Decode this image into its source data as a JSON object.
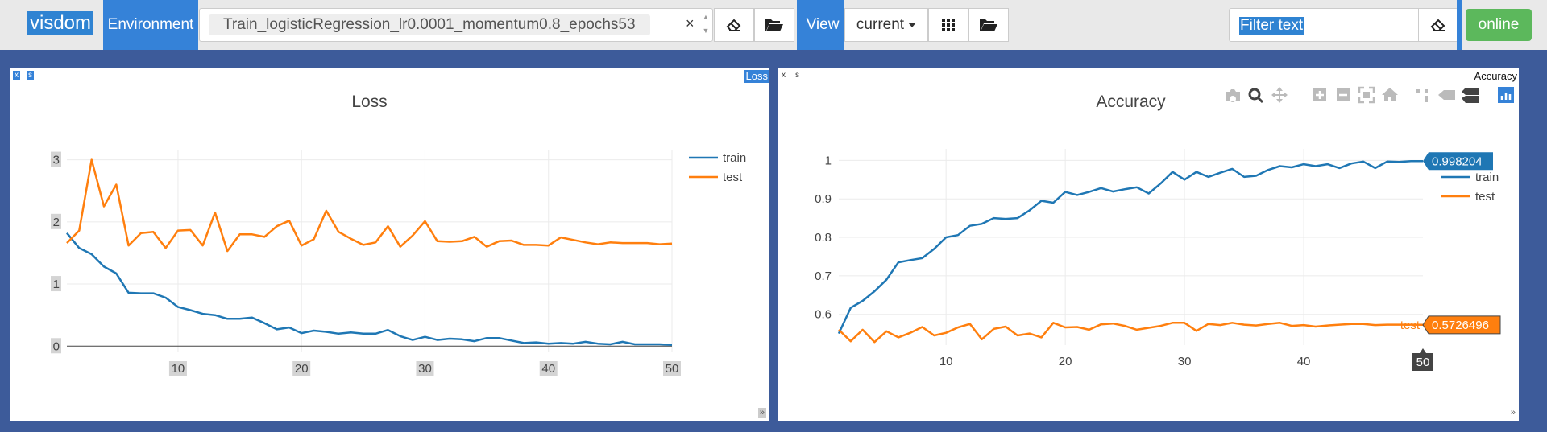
{
  "app": {
    "logo": "visdom",
    "environment_label": "Environment",
    "environment_value": "Train_logisticRegression_lr0.0001_momentum0.8_epochs53",
    "view_label": "View",
    "view_value": "current",
    "filter_text": "Filter text",
    "online_label": "online"
  },
  "panes": {
    "loss": {
      "close": "x",
      "save": "s",
      "tag": "Loss"
    },
    "accuracy": {
      "close": "x",
      "save": "s",
      "tag": "Accuracy"
    }
  },
  "colors": {
    "train": "#1f77b4",
    "test": "#ff7f0e",
    "accent": "#3582d8",
    "online": "#5cb85c"
  },
  "chart_data": [
    {
      "type": "line",
      "title": "Loss",
      "xlim": [
        1,
        50
      ],
      "ylim": [
        -0.1,
        3.15
      ],
      "xticks": [
        10,
        20,
        30,
        40,
        50
      ],
      "yticks": [
        0,
        1,
        2,
        3
      ],
      "grid": true,
      "legend": "top-right",
      "x": [
        1,
        2,
        3,
        4,
        5,
        6,
        7,
        8,
        9,
        10,
        11,
        12,
        13,
        14,
        15,
        16,
        17,
        18,
        19,
        20,
        21,
        22,
        23,
        24,
        25,
        26,
        27,
        28,
        29,
        30,
        31,
        32,
        33,
        34,
        35,
        36,
        37,
        38,
        39,
        40,
        41,
        42,
        43,
        44,
        45,
        46,
        47,
        48,
        49,
        50
      ],
      "series": [
        {
          "name": "train",
          "values": [
            1.82,
            1.58,
            1.48,
            1.28,
            1.17,
            0.86,
            0.85,
            0.85,
            0.78,
            0.63,
            0.58,
            0.52,
            0.5,
            0.44,
            0.44,
            0.46,
            0.37,
            0.27,
            0.3,
            0.21,
            0.25,
            0.23,
            0.2,
            0.22,
            0.2,
            0.2,
            0.26,
            0.16,
            0.1,
            0.15,
            0.1,
            0.12,
            0.11,
            0.08,
            0.13,
            0.13,
            0.09,
            0.05,
            0.06,
            0.04,
            0.05,
            0.04,
            0.07,
            0.04,
            0.03,
            0.07,
            0.03,
            0.03,
            0.03,
            0.02
          ]
        },
        {
          "name": "test",
          "values": [
            1.66,
            1.86,
            3.0,
            2.25,
            2.6,
            1.62,
            1.82,
            1.84,
            1.58,
            1.86,
            1.87,
            1.62,
            2.15,
            1.53,
            1.8,
            1.8,
            1.76,
            1.93,
            2.02,
            1.62,
            1.72,
            2.18,
            1.84,
            1.73,
            1.63,
            1.67,
            1.93,
            1.6,
            1.78,
            2.01,
            1.69,
            1.68,
            1.69,
            1.76,
            1.6,
            1.69,
            1.7,
            1.63,
            1.63,
            1.62,
            1.75,
            1.71,
            1.67,
            1.64,
            1.67,
            1.66,
            1.66,
            1.66,
            1.64,
            1.65
          ]
        }
      ]
    },
    {
      "type": "line",
      "title": "Accuracy",
      "xlim": [
        1,
        50
      ],
      "ylim": [
        0.52,
        1.03
      ],
      "xticks": [
        10,
        20,
        30,
        40
      ],
      "yticks": [
        0.6,
        0.7,
        0.8,
        0.9,
        1
      ],
      "ytick_labels": [
        "0.6",
        "0.7",
        "0.8",
        "0.9",
        "1"
      ],
      "grid": true,
      "legend": "top-right",
      "hover_x_label": "50",
      "hover_labels": {
        "train": "0.998204",
        "test": "0.5726496"
      },
      "x": [
        1,
        2,
        3,
        4,
        5,
        6,
        7,
        8,
        9,
        10,
        11,
        12,
        13,
        14,
        15,
        16,
        17,
        18,
        19,
        20,
        21,
        22,
        23,
        24,
        25,
        26,
        27,
        28,
        29,
        30,
        31,
        32,
        33,
        34,
        35,
        36,
        37,
        38,
        39,
        40,
        41,
        42,
        43,
        44,
        45,
        46,
        47,
        48,
        49,
        50
      ],
      "series": [
        {
          "name": "train",
          "values": [
            0.55,
            0.617,
            0.635,
            0.66,
            0.69,
            0.735,
            0.741,
            0.746,
            0.77,
            0.8,
            0.806,
            0.83,
            0.835,
            0.85,
            0.848,
            0.85,
            0.87,
            0.895,
            0.89,
            0.918,
            0.91,
            0.918,
            0.928,
            0.919,
            0.925,
            0.93,
            0.914,
            0.94,
            0.97,
            0.95,
            0.97,
            0.957,
            0.968,
            0.978,
            0.957,
            0.96,
            0.975,
            0.985,
            0.982,
            0.99,
            0.985,
            0.99,
            0.98,
            0.992,
            0.997,
            0.98,
            0.997,
            0.996,
            0.998,
            0.998
          ]
        },
        {
          "name": "test",
          "values": [
            0.56,
            0.53,
            0.56,
            0.528,
            0.556,
            0.54,
            0.552,
            0.567,
            0.545,
            0.552,
            0.566,
            0.575,
            0.535,
            0.562,
            0.568,
            0.545,
            0.55,
            0.54,
            0.578,
            0.566,
            0.567,
            0.56,
            0.574,
            0.576,
            0.57,
            0.56,
            0.565,
            0.57,
            0.578,
            0.578,
            0.557,
            0.575,
            0.572,
            0.578,
            0.573,
            0.571,
            0.575,
            0.578,
            0.57,
            0.572,
            0.568,
            0.571,
            0.573,
            0.575,
            0.575,
            0.572,
            0.573,
            0.573,
            0.573,
            0.5726
          ]
        }
      ]
    }
  ]
}
